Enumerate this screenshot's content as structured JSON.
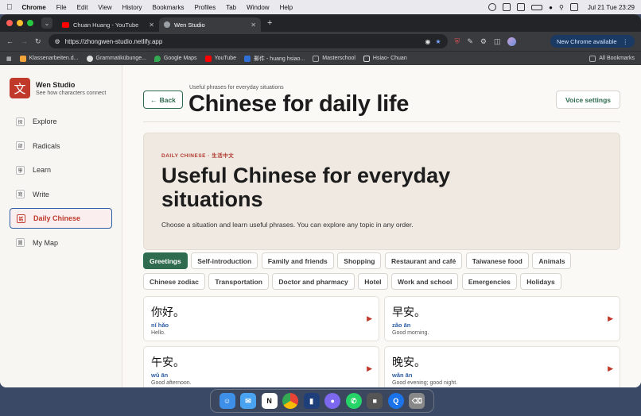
{
  "menubar": {
    "app": "Chrome",
    "items": [
      "File",
      "Edit",
      "View",
      "History",
      "Bookmarks",
      "Profiles",
      "Tab",
      "Window",
      "Help"
    ],
    "clock": "Jul 21 Tue  23:29"
  },
  "tabs": [
    {
      "title": "Chuan Huang - YouTube",
      "color": "#ff0000"
    },
    {
      "title": "Wen Studio",
      "color": "#9aa0a6"
    }
  ],
  "address": {
    "url": "https://zhongwen-studio.netlify.app",
    "update_label": "New Chrome available"
  },
  "bookmarks": [
    {
      "label": "Klassenarbeiten.d...",
      "color": "#f2a33a"
    },
    {
      "label": "Grammatikübunge...",
      "color": "#dddddd"
    },
    {
      "label": "Google Maps",
      "color": "#34a853"
    },
    {
      "label": "YouTube",
      "color": "#ff0000"
    },
    {
      "label": "郵件 - huang hsiao...",
      "color": "#2f6fd6"
    },
    {
      "label": "Masterschool",
      "color": "#aaaaaa"
    },
    {
      "label": "Hsiao- Chuan",
      "color": "#dddddd"
    }
  ],
  "all_bookmarks": "All Bookmarks",
  "sidebar": {
    "brand_title": "Wen Studio",
    "brand_sub": "See how characters connect",
    "logo_char": "文",
    "items": [
      {
        "label": "Explore",
        "icon": "探"
      },
      {
        "label": "Radicals",
        "icon": "部"
      },
      {
        "label": "Learn",
        "icon": "學"
      },
      {
        "label": "Write",
        "icon": "寫"
      },
      {
        "label": "Daily Chinese",
        "icon": "話"
      },
      {
        "label": "My Map",
        "icon": "圖"
      }
    ]
  },
  "header": {
    "back_label": "Back",
    "eyebrow": "Useful phrases for everyday situations",
    "title": "Chinese for daily life",
    "voice_label": "Voice settings"
  },
  "hero": {
    "eyebrow": "DAILY CHINESE · 生活中文",
    "title": "Useful Chinese for everyday situations",
    "description": "Choose a situation and learn useful phrases. You can explore any topic in any order."
  },
  "topics": [
    "Greetings",
    "Self-introduction",
    "Family and friends",
    "Shopping",
    "Restaurant and café",
    "Taiwanese food",
    "Animals",
    "Chinese zodiac",
    "Transportation",
    "Doctor and pharmacy",
    "Hotel",
    "Work and school",
    "Emergencies",
    "Holidays"
  ],
  "phrases": [
    {
      "hanzi": "你好。",
      "pinyin": "nǐ hǎo",
      "english": "Hello."
    },
    {
      "hanzi": "早安。",
      "pinyin": "zǎo ān",
      "english": "Good morning."
    },
    {
      "hanzi": "午安。",
      "pinyin": "wǔ ān",
      "english": "Good afternoon."
    },
    {
      "hanzi": "晚安。",
      "pinyin": "wǎn ān",
      "english": "Good evening; good night."
    }
  ],
  "colors": {
    "accent_green": "#2f6b4f",
    "accent_red": "#c0392b",
    "accent_blue": "#2f5fa5"
  }
}
